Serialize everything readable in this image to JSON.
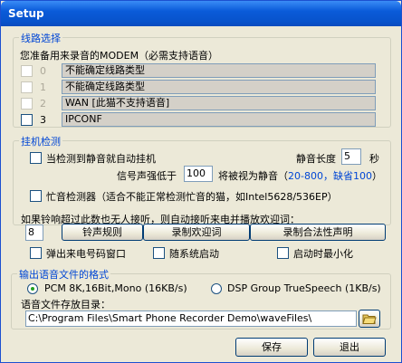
{
  "window": {
    "title": "Setup"
  },
  "line": {
    "group_title": "线路选择",
    "prompt": "您准备用来录音的MODEM（必需支持语音）",
    "rows": [
      {
        "num": "0",
        "value": "不能确定线路类型"
      },
      {
        "num": "1",
        "value": "不能确定线路类型"
      },
      {
        "num": "2",
        "value": "WAN [此猫不支持语音]"
      },
      {
        "num": "3",
        "value": "IPCONF"
      }
    ]
  },
  "hangup": {
    "group_title": "挂机检测",
    "silence_hangup_label": "当检测到静音就自动挂机",
    "silence_length_label": "静音长度",
    "silence_length_value": "5",
    "seconds_label": "秒",
    "signal_below_label": "信号声强低于",
    "signal_value": "100",
    "treated_label": "将被视为静音（",
    "range_text": "20-800，缺省100",
    "close_paren": "）",
    "busy_detector_label": "忙音检测器（适合不能正常检测忙音的猫，如Intel5628/536EP）"
  },
  "welcome": {
    "prompt": "如果铃响超过此数也无人接听，则自动接听来电并播放欢迎词：",
    "ring_value": "8",
    "ring_rules_button": "铃声规则",
    "record_welcome_button": "录制欢迎词",
    "record_legal_button": "录制合法性声明"
  },
  "options": {
    "popup_caller_label": "弹出来电号码窗口",
    "auto_start_label": "随系统启动",
    "minimize_label": "启动时最小化"
  },
  "output": {
    "group_title": "输出语音文件的格式",
    "pcm_label": "PCM 8K,16Bit,Mono (16KB/s)",
    "dsp_label": "DSP Group TrueSpeech (1KB/s)",
    "dir_label": "语音文件存放目录：",
    "dir_value": "C:\\Program Files\\Smart Phone Recorder Demo\\waveFiles\\"
  },
  "buttons": {
    "save": "保存",
    "exit": "退出"
  }
}
